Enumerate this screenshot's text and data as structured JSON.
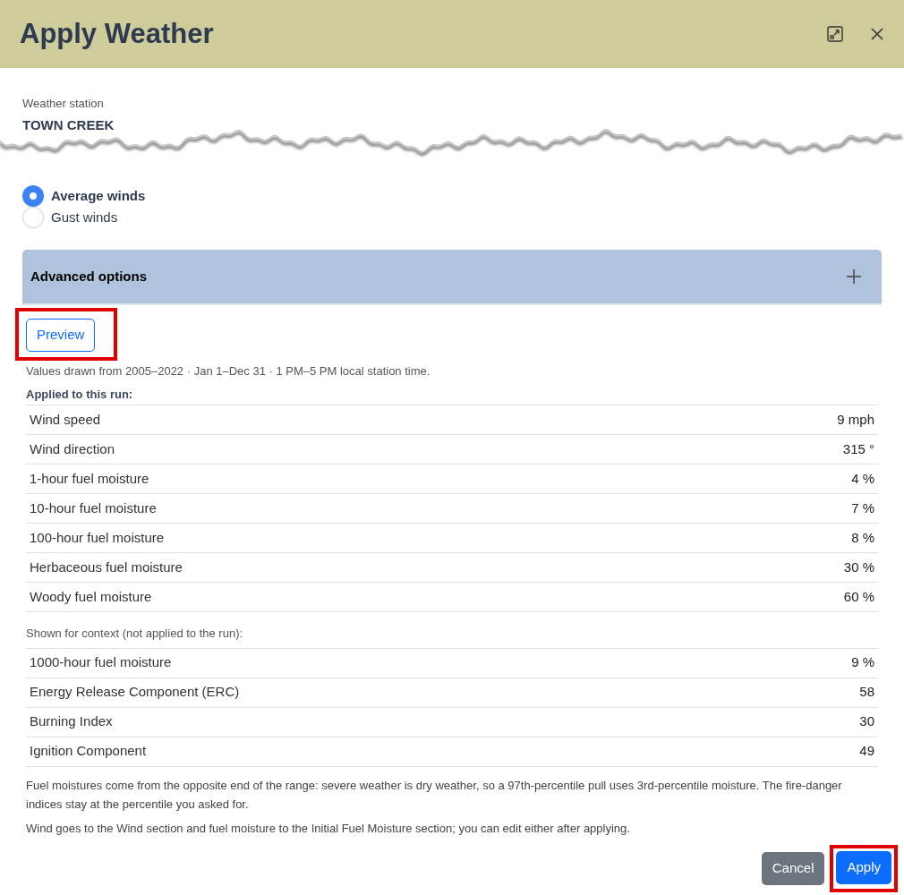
{
  "dialog": {
    "title": "Apply Weather"
  },
  "station": {
    "label": "Weather station",
    "value": "TOWN CREEK"
  },
  "wind_options": [
    {
      "label": "Average winds",
      "selected": true
    },
    {
      "label": "Gust winds",
      "selected": false
    }
  ],
  "advanced": {
    "label": "Advanced options",
    "expanded": false
  },
  "preview": {
    "label": "Preview",
    "highlighted": true
  },
  "source_note": "Values drawn from 2005–2022 · Jan 1–Dec 31 · 1 PM–5 PM local station time.",
  "applied": {
    "heading": "Applied to this run:",
    "rows": [
      {
        "name": "Wind speed",
        "value": "9 mph"
      },
      {
        "name": "Wind direction",
        "value": "315 °"
      },
      {
        "name": "1-hour fuel moisture",
        "value": "4 %"
      },
      {
        "name": "10-hour fuel moisture",
        "value": "7 %"
      },
      {
        "name": "100-hour fuel moisture",
        "value": "8 %"
      },
      {
        "name": "Herbaceous fuel moisture",
        "value": "30 %"
      },
      {
        "name": "Woody fuel moisture",
        "value": "60 %"
      }
    ]
  },
  "context": {
    "heading": "Shown for context (not applied to the run):",
    "rows": [
      {
        "name": "1000-hour fuel moisture",
        "value": "9 %"
      },
      {
        "name": "Energy Release Component (ERC)",
        "value": "58"
      },
      {
        "name": "Burning Index",
        "value": "30"
      },
      {
        "name": "Ignition Component",
        "value": "49"
      }
    ]
  },
  "notes": [
    "Fuel moistures come from the opposite end of the range: severe weather is dry weather, so a 97th-percentile pull uses 3rd-percentile moisture. The fire-danger indices stay at the percentile you asked for.",
    "Wind goes to the Wind section and fuel moisture to the Initial Fuel Moisture section; you can edit either after applying."
  ],
  "buttons": [
    {
      "label": "Cancel",
      "kind": "secondary",
      "highlighted": false
    },
    {
      "label": "Apply",
      "kind": "primary",
      "highlighted": true
    }
  ]
}
